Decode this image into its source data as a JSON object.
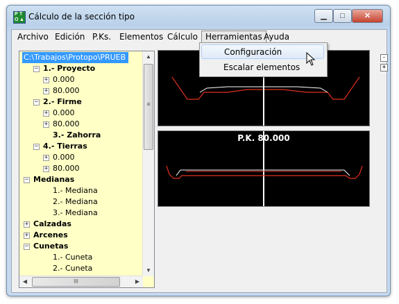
{
  "window": {
    "title": "Cálculo de la sección tipo",
    "icon": "app-logo-icon",
    "controls": {
      "minimize": "▁",
      "maximize": "□",
      "close": "✕"
    }
  },
  "menubar": {
    "items": [
      "Archivo",
      "Edición",
      "P.Ks.",
      "Elementos",
      "Cálculo",
      "Herramientas",
      "Ayuda"
    ],
    "open_menu": "Herramientas"
  },
  "dropdown": {
    "items": [
      "Configuración",
      "Escalar elementos"
    ],
    "hovered": "Configuración"
  },
  "tree": {
    "items": [
      {
        "label": "C:\\Trabajos\\Protopo\\PRUEB",
        "selected": true
      },
      {
        "label": "1.- Proyecto"
      },
      {
        "label": "0.000"
      },
      {
        "label": "80.000"
      },
      {
        "label": "2.- Firme"
      },
      {
        "label": "0.000"
      },
      {
        "label": "80.000"
      },
      {
        "label": "3.- Zahorra"
      },
      {
        "label": "4.- Tierras"
      },
      {
        "label": "0.000"
      },
      {
        "label": "80.000"
      },
      {
        "label": "Medianas"
      },
      {
        "label": "1.- Mediana"
      },
      {
        "label": "2.- Mediana"
      },
      {
        "label": "3.- Mediana"
      },
      {
        "label": "Calzadas"
      },
      {
        "label": "Arcenes"
      },
      {
        "label": "Cunetas"
      },
      {
        "label": "1.- Cuneta"
      },
      {
        "label": "2.- Cuneta"
      }
    ],
    "scroll_h_grip": "III",
    "scroll_v_grip": "≡"
  },
  "drawings": {
    "bottom_label": "P.K. 80.000",
    "zoom_out": "-",
    "zoom_in": "+"
  },
  "colors": {
    "tree_background": "#ffffc6",
    "selection": "#3399ff",
    "canvas_background": "#000000",
    "profile_red": "#e03020",
    "profile_white": "#ffffff"
  }
}
